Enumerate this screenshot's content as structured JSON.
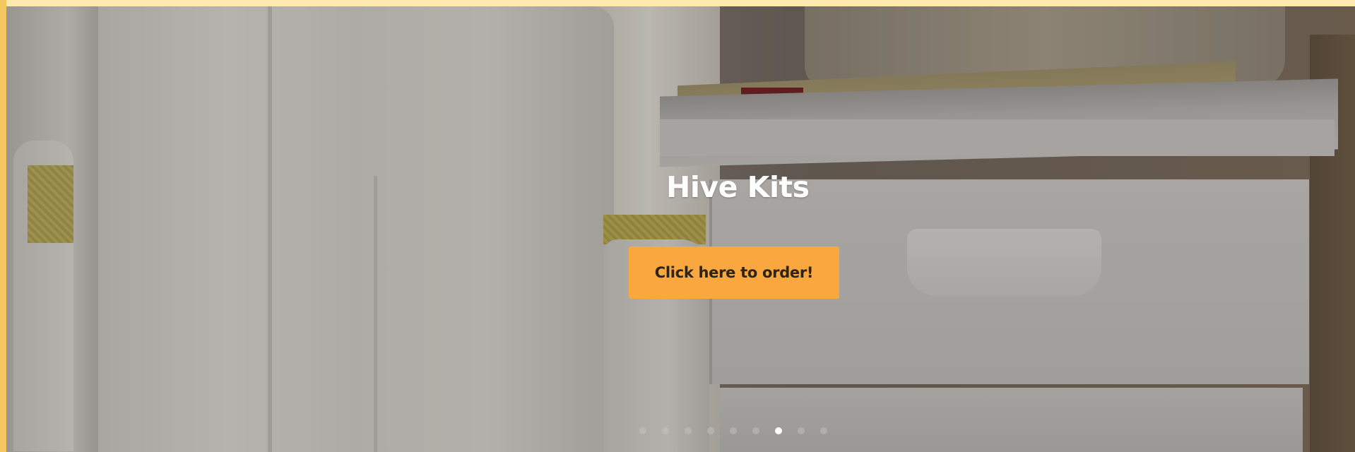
{
  "slide": {
    "title": "Hive Kits",
    "button_label": "Click here to order!",
    "background_image": "beekeeper-suit-and-hive-photo"
  },
  "pagination": {
    "total": 9,
    "active_index": 6
  },
  "colors": {
    "frame": "#f4c860",
    "button_bg": "#f9a73e",
    "button_text": "#2b2418",
    "title_text": "#ffffff",
    "dot_active": "#ffffff",
    "dot_inactive": "#c8c8c8"
  }
}
